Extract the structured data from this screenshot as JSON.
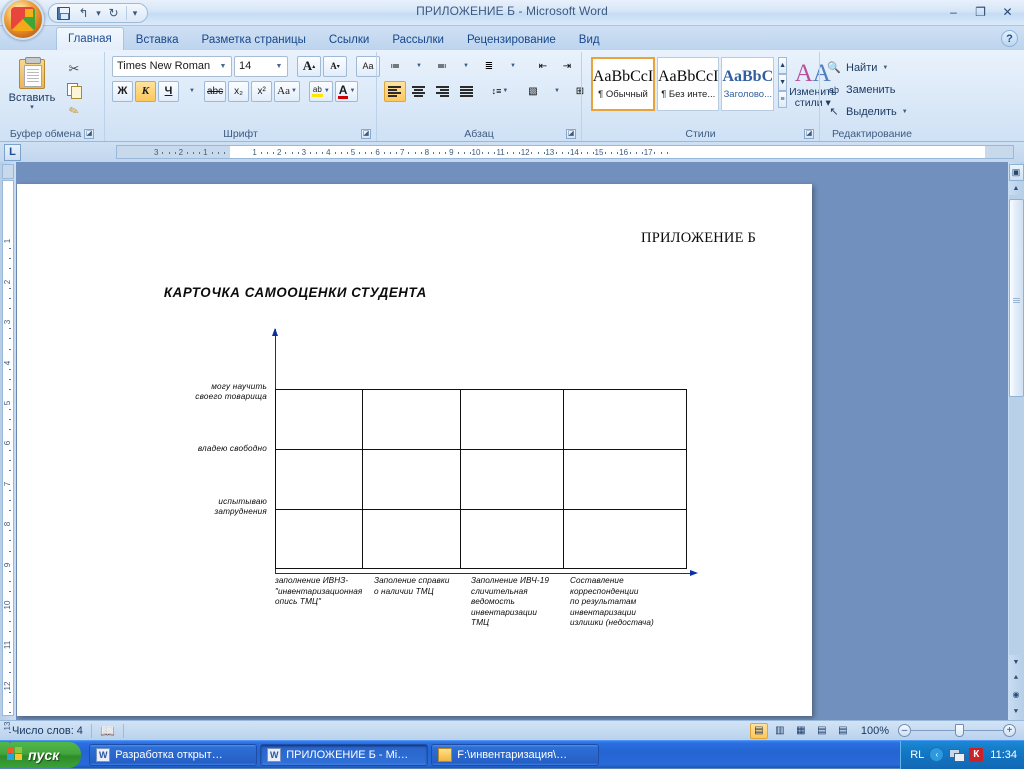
{
  "window": {
    "title": "ПРИЛОЖЕНИЕ Б - Microsoft Word",
    "minimize": "–",
    "restore": "❐",
    "close": "✕",
    "help": "?"
  },
  "quick_access": {
    "save": "save-icon",
    "undo": "↰",
    "undo_arrow": "▾",
    "redo": "↻",
    "customize": "▾"
  },
  "tabs": [
    {
      "label": "Главная",
      "active": true
    },
    {
      "label": "Вставка",
      "active": false
    },
    {
      "label": "Разметка страницы",
      "active": false
    },
    {
      "label": "Ссылки",
      "active": false
    },
    {
      "label": "Рассылки",
      "active": false
    },
    {
      "label": "Рецензирование",
      "active": false
    },
    {
      "label": "Вид",
      "active": false
    }
  ],
  "ribbon": {
    "clipboard": {
      "group_label": "Буфер обмена",
      "paste_label": "Вставить",
      "paste_arrow": "▾",
      "cut": "✂",
      "copy": "copy-icon",
      "format_painter": "✎"
    },
    "font": {
      "group_label": "Шрифт",
      "font_name": "Times New Roman",
      "font_size": "14",
      "grow_font": "A",
      "shrink_font": "A",
      "clear_formatting": "Aa",
      "bold": "Ж",
      "italic": "К",
      "underline": "Ч",
      "strikethrough": "abc",
      "subscript": "x₂",
      "superscript": "x²",
      "change_case": "Aa",
      "highlight": "ab",
      "font_color": "A"
    },
    "paragraph": {
      "group_label": "Абзац",
      "bullets": "•≡",
      "numbering": "1≡",
      "multilevel": "≡",
      "decrease_indent": "◄≡",
      "increase_indent": "►≡",
      "sort": "AЯ↓",
      "show_marks": "¶",
      "align_left": "≡",
      "align_center": "≡",
      "align_right": "≡",
      "justify": "≡",
      "line_spacing": "↕≡",
      "shading": "▧",
      "borders": "⊞"
    },
    "styles": {
      "group_label": "Стили",
      "items": [
        {
          "sample": "AaBbCcI",
          "name": "¶ Обычный",
          "active": true,
          "blue": false
        },
        {
          "sample": "AaBbCcI",
          "name": "¶ Без инте...",
          "active": false,
          "blue": false
        },
        {
          "sample": "AaBbC",
          "name": "Заголово...",
          "active": false,
          "blue": true
        }
      ],
      "scroll_up": "▲",
      "scroll_down": "▼",
      "more": "▾",
      "change_styles_label_line1": "Изменить",
      "change_styles_label_line2": "стили ▾"
    },
    "editing": {
      "group_label": "Редактирование",
      "find": "Найти",
      "find_arrow": "▾",
      "replace": "Заменить",
      "select": "Выделить",
      "select_arrow": "▾",
      "find_icon": "🔍",
      "replace_icon": "ab",
      "select_icon": "↖"
    }
  },
  "ruler": {
    "tab_selector": "L",
    "h_marks": [
      "3",
      "2",
      "1",
      "1",
      "2",
      "3",
      "4",
      "5",
      "6",
      "7",
      "8",
      "9",
      "10",
      "11",
      "12",
      "13",
      "14",
      "15",
      "16",
      "17"
    ],
    "v_marks": [
      "1",
      "2",
      "3",
      "4",
      "5",
      "6",
      "7",
      "8",
      "9",
      "10",
      "11",
      "12",
      "13"
    ]
  },
  "document": {
    "header_right": "ПРИЛОЖЕНИЕ Б",
    "title": "КАРТОЧКА САМООЦЕНКИ СТУДЕНТА"
  },
  "chart_data": {
    "type": "table",
    "title": "КАРТОЧКА САМООЦЕНКИ СТУДЕНТА",
    "xlabel": "",
    "ylabel": "",
    "grid": true,
    "rows": 3,
    "columns": 4,
    "y_categories": [
      "могу научить\nсвоего товарища",
      "владею свободно",
      "испытываю\nзатруднения"
    ],
    "y_labels": [
      {
        "line1": "могу научить",
        "line2": "своего товарища"
      },
      {
        "line1": "владею свободно",
        "line2": ""
      },
      {
        "line1": "испытываю",
        "line2": "затруднения"
      }
    ],
    "x_categories": [
      "заполнение ИВНЗ - \"инвентаризационная опись ТМЦ\"",
      "Заполение справки о наличии ТМЦ",
      "Заполнение ИВЧ-19 сличительная ведомость инвентаризации ТМЦ",
      "Составление корреспонденции по результатам инвентаризации излишки (недостача)"
    ],
    "x_labels": [
      [
        "заполнение ИВНЗ-",
        "\"инвентаризационная",
        "опись ТМЦ\""
      ],
      [
        "Заполение справки",
        "о наличии ТМЦ"
      ],
      [
        "Заполнение ИВЧ-19",
        "сличительная",
        "ведомость",
        "инвентаризации",
        "ТМЦ"
      ],
      [
        "Составление",
        "корреспонденции",
        "по результатам",
        "инвентаризации",
        "излишки (недостача)"
      ]
    ],
    "values": [],
    "axis_color": "#0b2ea0",
    "grid_color": "#111111"
  },
  "status_bar": {
    "word_count": "Число слов: 4",
    "proofing_icon": "📖",
    "views": [
      {
        "name": "print-layout",
        "glyph": "▤",
        "active": true
      },
      {
        "name": "full-screen-reading",
        "glyph": "▥",
        "active": false
      },
      {
        "name": "web-layout",
        "glyph": "▦",
        "active": false
      },
      {
        "name": "outline",
        "glyph": "▤",
        "active": false
      },
      {
        "name": "draft",
        "glyph": "▤",
        "active": false
      }
    ],
    "zoom": "100%",
    "zoom_out": "–",
    "zoom_in": "+"
  },
  "taskbar": {
    "start": "пуск",
    "items": [
      {
        "label": "Разработка открыт…",
        "icon": "word",
        "active": false
      },
      {
        "label": "ПРИЛОЖЕНИЕ Б - Mi…",
        "icon": "word",
        "active": true
      },
      {
        "label": "F:\\инвентаризация\\…",
        "icon": "folder",
        "active": false
      }
    ],
    "tray": {
      "language": "RL",
      "chevron": "‹",
      "network": "network-icon",
      "antivirus": "К",
      "clock": "11:34"
    }
  },
  "colors": {
    "accent": "#1d4f93",
    "axis": "#0b2ea0",
    "taskbar": "#2464d3",
    "start": "#43a53c",
    "highlight": "#fdc75a"
  }
}
